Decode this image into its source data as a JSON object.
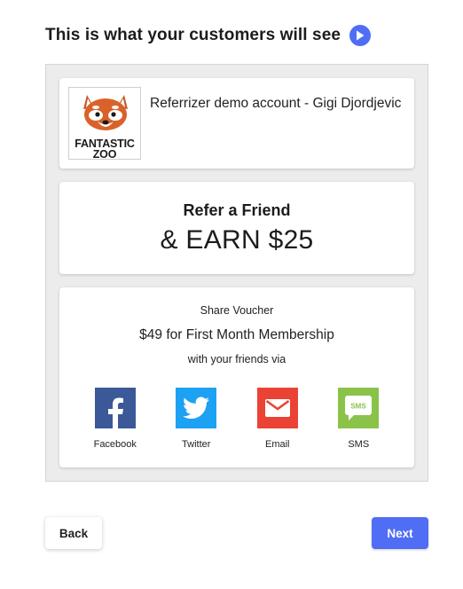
{
  "header": {
    "title": "This is what your customers will see",
    "play_icon": "play-circle-icon"
  },
  "account": {
    "logo_line1": "FANTASTIC",
    "logo_line2": "ZOO",
    "logo_icon": "red-panda-logo",
    "name": "Referrizer demo account - Gigi Djordjevic"
  },
  "refer": {
    "title": "Refer a Friend",
    "reward": "& EARN $25"
  },
  "share": {
    "label": "Share Voucher",
    "offer": "$49 for First Month Membership",
    "sub": "with your friends via",
    "channels": [
      {
        "label": "Facebook",
        "icon": "facebook-icon",
        "color": "#3b5998"
      },
      {
        "label": "Twitter",
        "icon": "twitter-icon",
        "color": "#1da1f2"
      },
      {
        "label": "Email",
        "icon": "email-icon",
        "color": "#ea4335"
      },
      {
        "label": "SMS",
        "icon": "sms-icon",
        "sms_text": "SMS",
        "color": "#8bc34a"
      }
    ]
  },
  "footer": {
    "back_label": "Back",
    "next_label": "Next"
  },
  "colors": {
    "accent": "#4f6ef5",
    "panel_bg": "#ececec"
  }
}
